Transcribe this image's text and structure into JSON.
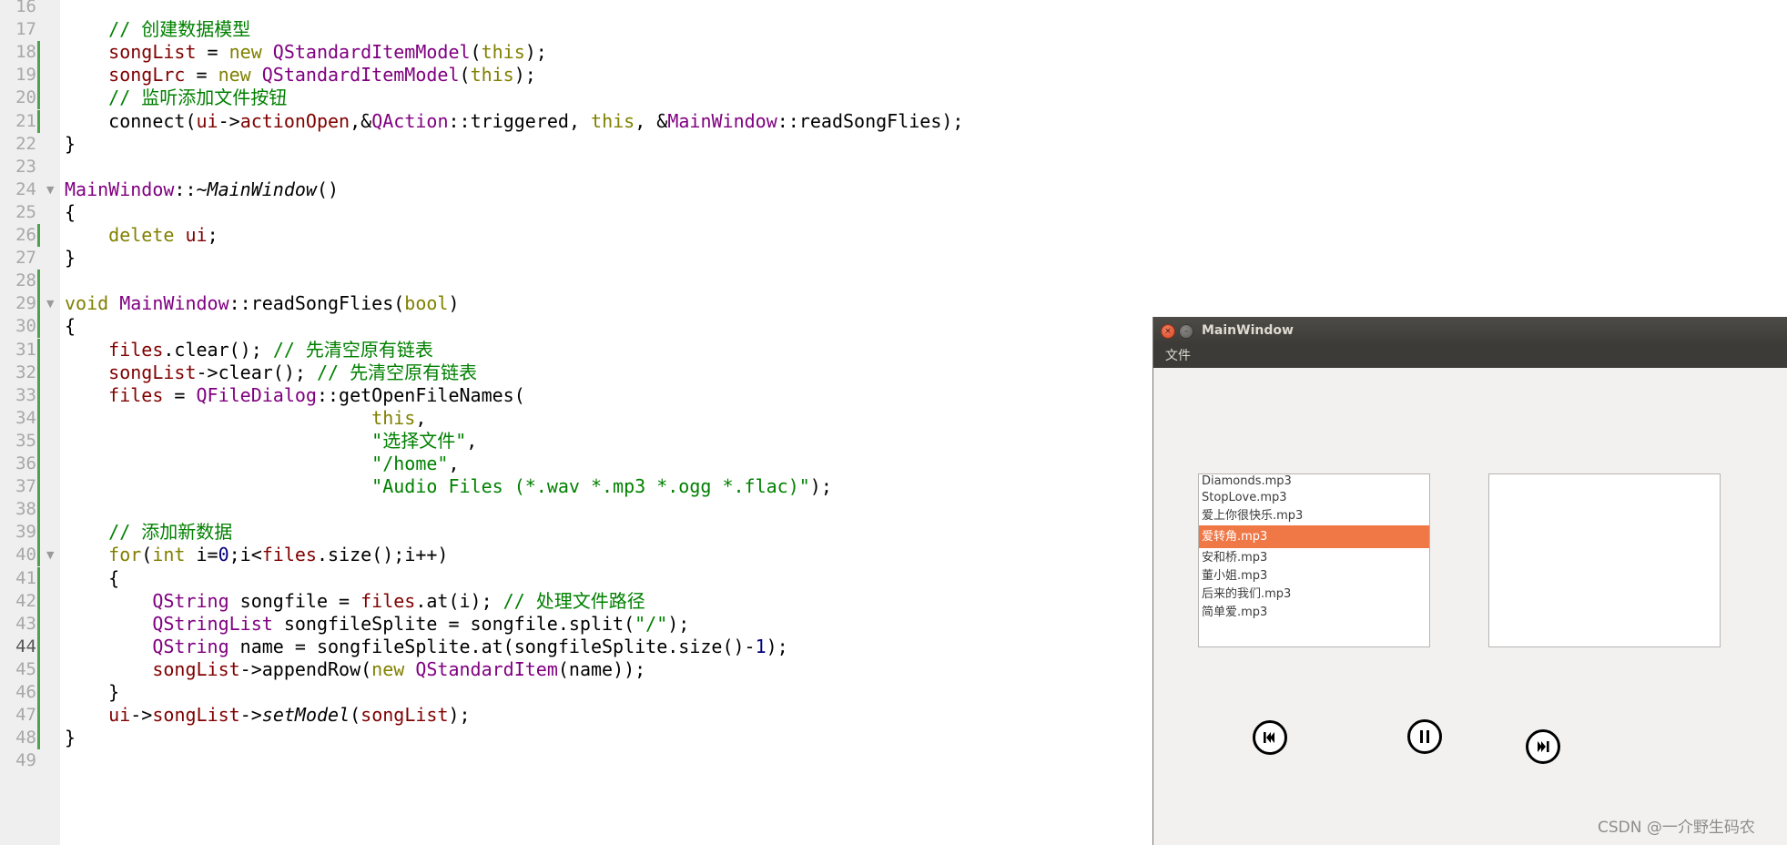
{
  "editor": {
    "lines": [
      {
        "n": "16",
        "segs": []
      },
      {
        "n": "17",
        "segs": [
          [
            "t-c",
            "    // 创建数据模型"
          ]
        ]
      },
      {
        "n": "18",
        "mark": true,
        "segs": [
          [
            "",
            "    "
          ],
          [
            "t-v",
            "songList"
          ],
          [
            "",
            " = "
          ],
          [
            "t-kw",
            "new"
          ],
          [
            "",
            " "
          ],
          [
            "t-ty",
            "QStandardItemModel"
          ],
          [
            "",
            "("
          ],
          [
            "t-kw",
            "this"
          ],
          [
            "",
            ");"
          ]
        ]
      },
      {
        "n": "19",
        "mark": true,
        "segs": [
          [
            "",
            "    "
          ],
          [
            "t-v",
            "songLrc"
          ],
          [
            "",
            " = "
          ],
          [
            "t-kw",
            "new"
          ],
          [
            "",
            " "
          ],
          [
            "t-ty",
            "QStandardItemModel"
          ],
          [
            "",
            "("
          ],
          [
            "t-kw",
            "this"
          ],
          [
            "",
            ");"
          ]
        ]
      },
      {
        "n": "20",
        "mark": true,
        "segs": [
          [
            "t-c",
            "    // 监听添加文件按钮"
          ]
        ]
      },
      {
        "n": "21",
        "mark": true,
        "segs": [
          [
            "",
            "    connect("
          ],
          [
            "t-v",
            "ui"
          ],
          [
            "",
            "->"
          ],
          [
            "t-v",
            "actionOpen"
          ],
          [
            "",
            ",&"
          ],
          [
            "t-ty",
            "QAction"
          ],
          [
            "",
            "::triggered, "
          ],
          [
            "t-kw",
            "this"
          ],
          [
            "",
            ", &"
          ],
          [
            "t-ty",
            "MainWindow"
          ],
          [
            "",
            "::readSongFlies);"
          ]
        ]
      },
      {
        "n": "22",
        "segs": [
          [
            "",
            "}"
          ]
        ]
      },
      {
        "n": "23",
        "segs": []
      },
      {
        "n": "24",
        "fold": true,
        "segs": [
          [
            "t-ty",
            "MainWindow"
          ],
          [
            "",
            "::~"
          ],
          [
            "t-i",
            "MainWindow"
          ],
          [
            "",
            "()"
          ]
        ]
      },
      {
        "n": "25",
        "segs": [
          [
            "",
            "{"
          ]
        ]
      },
      {
        "n": "26",
        "mark": true,
        "segs": [
          [
            "",
            "    "
          ],
          [
            "t-kw",
            "delete"
          ],
          [
            "",
            " "
          ],
          [
            "t-v",
            "ui"
          ],
          [
            "",
            ";"
          ]
        ]
      },
      {
        "n": "27",
        "segs": [
          [
            "",
            "}"
          ]
        ]
      },
      {
        "n": "28",
        "mark": true,
        "segs": []
      },
      {
        "n": "29",
        "fold": true,
        "mark": true,
        "segs": [
          [
            "t-kw",
            "void"
          ],
          [
            "",
            " "
          ],
          [
            "t-ty",
            "MainWindow"
          ],
          [
            "",
            "::readSongFlies("
          ],
          [
            "t-kw",
            "bool"
          ],
          [
            "",
            ")"
          ]
        ]
      },
      {
        "n": "30",
        "mark": true,
        "segs": [
          [
            "",
            "{"
          ]
        ]
      },
      {
        "n": "31",
        "mark": true,
        "segs": [
          [
            "",
            "    "
          ],
          [
            "t-v",
            "files"
          ],
          [
            "",
            ".clear(); "
          ],
          [
            "t-c",
            "// 先清空原有链表"
          ]
        ]
      },
      {
        "n": "32",
        "mark": true,
        "segs": [
          [
            "",
            "    "
          ],
          [
            "t-v",
            "songList"
          ],
          [
            "",
            "->clear(); "
          ],
          [
            "t-c",
            "// 先清空原有链表"
          ]
        ]
      },
      {
        "n": "33",
        "mark": true,
        "segs": [
          [
            "",
            "    "
          ],
          [
            "t-v",
            "files"
          ],
          [
            "",
            " = "
          ],
          [
            "t-ty",
            "QFileDialog"
          ],
          [
            "",
            "::getOpenFileNames("
          ]
        ]
      },
      {
        "n": "34",
        "mark": true,
        "segs": [
          [
            "",
            "                            "
          ],
          [
            "t-kw",
            "this"
          ],
          [
            "",
            ","
          ]
        ]
      },
      {
        "n": "35",
        "mark": true,
        "segs": [
          [
            "",
            "                            "
          ],
          [
            "t-s",
            "\"选择文件\""
          ],
          [
            "",
            ","
          ]
        ]
      },
      {
        "n": "36",
        "mark": true,
        "segs": [
          [
            "",
            "                            "
          ],
          [
            "t-s",
            "\"/home\""
          ],
          [
            "",
            ","
          ]
        ]
      },
      {
        "n": "37",
        "mark": true,
        "segs": [
          [
            "",
            "                            "
          ],
          [
            "t-s",
            "\"Audio Files (*.wav *.mp3 *.ogg *.flac)\""
          ],
          [
            "",
            ");"
          ]
        ]
      },
      {
        "n": "38",
        "mark": true,
        "segs": []
      },
      {
        "n": "39",
        "mark": true,
        "segs": [
          [
            "t-c",
            "    // 添加新数据"
          ]
        ]
      },
      {
        "n": "40",
        "fold": true,
        "mark": true,
        "segs": [
          [
            "",
            "    "
          ],
          [
            "t-kw",
            "for"
          ],
          [
            "",
            "("
          ],
          [
            "t-kw",
            "int"
          ],
          [
            "",
            " i="
          ],
          [
            "t-n",
            "0"
          ],
          [
            "",
            ";i<"
          ],
          [
            "t-v",
            "files"
          ],
          [
            "",
            ".size();i++)"
          ]
        ]
      },
      {
        "n": "41",
        "mark": true,
        "segs": [
          [
            "",
            "    {"
          ]
        ]
      },
      {
        "n": "42",
        "mark": true,
        "segs": [
          [
            "",
            "        "
          ],
          [
            "t-ty",
            "QString"
          ],
          [
            "",
            " songfile = "
          ],
          [
            "t-v",
            "files"
          ],
          [
            "",
            ".at(i); "
          ],
          [
            "t-c",
            "// 处理文件路径"
          ]
        ]
      },
      {
        "n": "43",
        "mark": true,
        "segs": [
          [
            "",
            "        "
          ],
          [
            "t-ty",
            "QStringList"
          ],
          [
            "",
            " songfileSplite = songfile.split("
          ],
          [
            "t-s",
            "\"/\""
          ],
          [
            "",
            ");"
          ]
        ]
      },
      {
        "n": "44",
        "mark": true,
        "current": true,
        "segs": [
          [
            "",
            "        "
          ],
          [
            "t-ty",
            "QString"
          ],
          [
            "",
            " name = songfileSplite.at(songfileSplite.size()-"
          ],
          [
            "t-n",
            "1"
          ],
          [
            "",
            ");"
          ]
        ]
      },
      {
        "n": "45",
        "mark": true,
        "segs": [
          [
            "",
            "        "
          ],
          [
            "t-v",
            "songList"
          ],
          [
            "",
            "->appendRow("
          ],
          [
            "t-kw",
            "new"
          ],
          [
            "",
            " "
          ],
          [
            "t-ty",
            "QStandardItem"
          ],
          [
            "",
            "(name));"
          ]
        ]
      },
      {
        "n": "46",
        "mark": true,
        "segs": [
          [
            "",
            "    }"
          ]
        ]
      },
      {
        "n": "47",
        "mark": true,
        "segs": [
          [
            "",
            "    "
          ],
          [
            "t-v",
            "ui"
          ],
          [
            "",
            "->"
          ],
          [
            "t-v",
            "songList"
          ],
          [
            "",
            "->"
          ],
          [
            "t-i",
            "setModel"
          ],
          [
            "",
            "("
          ],
          [
            "t-v",
            "songList"
          ],
          [
            "",
            ");"
          ]
        ]
      },
      {
        "n": "48",
        "mark": true,
        "segs": [
          [
            "",
            "}"
          ]
        ]
      },
      {
        "n": "49",
        "segs": []
      }
    ]
  },
  "window": {
    "title": "MainWindow",
    "close_glyph": "×",
    "min_glyph": "–",
    "menu_file": "文件",
    "songs": [
      "Diamonds.mp3",
      "StopLove.mp3",
      "爱上你很快乐.mp3",
      "爱转角.mp3",
      "安和桥.mp3",
      "董小姐.mp3",
      "后来的我们.mp3",
      "简单爱.mp3"
    ],
    "selected_index": 3,
    "selection_color": "#f07746",
    "buttons": [
      "previous-track-icon",
      "pause-icon",
      "next-track-icon"
    ]
  },
  "watermark": "CSDN @一介野生码农"
}
